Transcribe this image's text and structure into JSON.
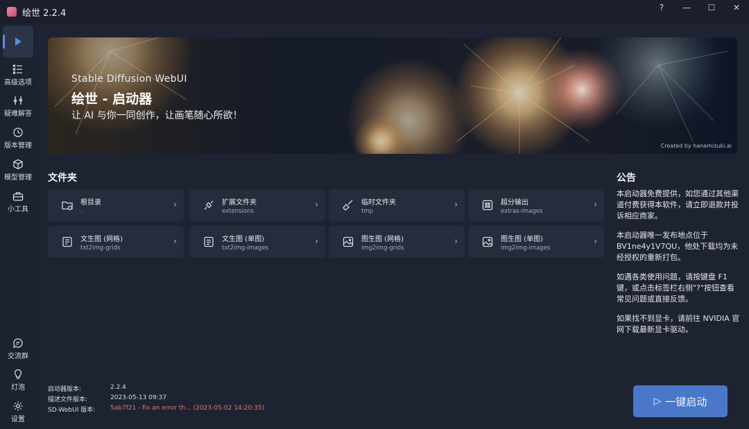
{
  "app": {
    "title": "绘世 2.2.4"
  },
  "window_controls": {
    "help": "?",
    "minimize": "—",
    "maximize": "☐",
    "close": "✕"
  },
  "sidebar": {
    "items": [
      {
        "label": "高级选项",
        "icon": "list-icon"
      },
      {
        "label": "疑难解答",
        "icon": "wrench-icon"
      },
      {
        "label": "版本管理",
        "icon": "history-icon"
      },
      {
        "label": "模型管理",
        "icon": "cube-icon"
      },
      {
        "label": "小工具",
        "icon": "toolbox-icon"
      }
    ],
    "bottom_items": [
      {
        "label": "交流群",
        "icon": "chat-icon"
      },
      {
        "label": "灯泡",
        "icon": "bulb-icon"
      },
      {
        "label": "设置",
        "icon": "gear-icon"
      }
    ]
  },
  "banner": {
    "subtitle": "Stable Diffusion WebUI",
    "title": "绘世 - 启动器",
    "tagline": "让 AI 与你一同创作，让画笔随心所欲！",
    "credit": "Created by hanamizuki.ai"
  },
  "folders": {
    "title": "文件夹",
    "items": [
      {
        "name": "根目录",
        "path": ".",
        "icon": "folder-icon"
      },
      {
        "name": "扩展文件夹",
        "path": "extensions",
        "icon": "plug-icon"
      },
      {
        "name": "临时文件夹",
        "path": "tmp",
        "icon": "broom-icon"
      },
      {
        "name": "超分输出",
        "path": "extras-images",
        "icon": "grid-icon"
      },
      {
        "name": "文生图 (网格)",
        "path": "txt2img-grids",
        "icon": "document-grid-icon"
      },
      {
        "name": "文生图 (单图)",
        "path": "txt2img-images",
        "icon": "document-icon"
      },
      {
        "name": "图生图 (网格)",
        "path": "img2img-grids",
        "icon": "image-grid-icon"
      },
      {
        "name": "图生图 (单图)",
        "path": "img2img-images",
        "icon": "image-icon"
      }
    ]
  },
  "notice": {
    "title": "公告",
    "paragraphs": [
      "本启动器免费提供，如您通过其他渠道付费获得本软件，请立即退款并投诉相应商家。",
      "本启动器唯一发布地点位于 BV1ne4y1V7QU，他处下载均为未经授权的重新打包。",
      "如遇各类使用问题，请按键盘 F1 键，或点击标签栏右侧\"?\"按钮查看常见问题或直接反馈。",
      "如果找不到显卡，请前往 NVIDIA 官网下载最新显卡驱动。"
    ]
  },
  "info": {
    "launcher_version_label": "启动器版本:",
    "launcher_version": "2.2.4",
    "desc_version_label": "描述文件版本:",
    "desc_version": "2023-05-13 09:37",
    "webui_version_label": "SD-WebUI 版本:",
    "webui_version": "5ab7f21 - fix an error th... (2023-05-02 14:20:35)"
  },
  "launch_button": {
    "icon": "▷",
    "label": "一键启动"
  },
  "colors": {
    "accent": "#4a78c8",
    "background": "#1e2332",
    "card": "#262c3b",
    "warning": "#e0786a"
  }
}
